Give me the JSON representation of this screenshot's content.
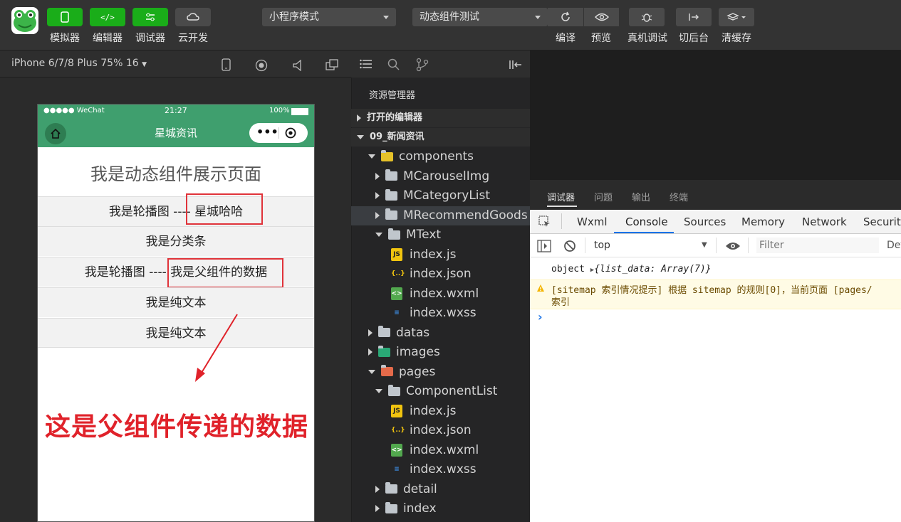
{
  "toolbar": {
    "buttons": [
      {
        "label": "模拟器"
      },
      {
        "label": "编辑器"
      },
      {
        "label": "调试器"
      },
      {
        "label": "云开发"
      }
    ],
    "mode_select": "小程序模式",
    "compile_select": "动态组件测试",
    "right_buttons": [
      {
        "label": "编译"
      },
      {
        "label": "预览"
      },
      {
        "label": "真机调试"
      },
      {
        "label": "切后台"
      },
      {
        "label": "清缓存"
      }
    ]
  },
  "simulator": {
    "device": "iPhone 6/7/8 Plus 75% 16",
    "status": {
      "carrier": "●●●●● WeChat",
      "time": "21:27",
      "battery": "100%"
    },
    "nav_title": "星城资讯",
    "heading": "我是动态组件展示页面",
    "rows": [
      {
        "left": "我是轮播图 ---- ",
        "right": "星城哈哈"
      },
      {
        "text": "我是分类条"
      },
      {
        "left": "我是轮播图 ---- ",
        "right": "我是父组件的数据"
      },
      {
        "text": "我是纯文本"
      },
      {
        "text": "我是纯文本"
      }
    ],
    "annotation": "这是父组件传递的数据"
  },
  "explorer": {
    "title": "资源管理器",
    "open_editors": "打开的编辑器",
    "project": "09_新闻资讯",
    "tree": [
      {
        "label": "components",
        "kind": "folder-open",
        "depth": 1
      },
      {
        "label": "MCarouselImg",
        "kind": "folder",
        "depth": 2
      },
      {
        "label": "MCategoryList",
        "kind": "folder",
        "depth": 2
      },
      {
        "label": "MRecommendGoods",
        "kind": "folder",
        "depth": 2
      },
      {
        "label": "MText",
        "kind": "folder-open",
        "depth": 2
      },
      {
        "label": "index.js",
        "kind": "js",
        "depth": 3
      },
      {
        "label": "index.json",
        "kind": "json",
        "depth": 3
      },
      {
        "label": "index.wxml",
        "kind": "wxml",
        "depth": 3
      },
      {
        "label": "index.wxss",
        "kind": "wxss",
        "depth": 3
      },
      {
        "label": "datas",
        "kind": "folder",
        "depth": 1
      },
      {
        "label": "images",
        "kind": "folder-img",
        "depth": 1
      },
      {
        "label": "pages",
        "kind": "folder-open-red",
        "depth": 1
      },
      {
        "label": "ComponentList",
        "kind": "folder-open",
        "depth": 2
      },
      {
        "label": "index.js",
        "kind": "js",
        "depth": 3
      },
      {
        "label": "index.json",
        "kind": "json",
        "depth": 3
      },
      {
        "label": "index.wxml",
        "kind": "wxml",
        "depth": 3
      },
      {
        "label": "index.wxss",
        "kind": "wxss",
        "depth": 3
      },
      {
        "label": "detail",
        "kind": "folder",
        "depth": 2
      },
      {
        "label": "index",
        "kind": "folder",
        "depth": 2
      }
    ]
  },
  "debugger": {
    "tabs": [
      "调试器",
      "问题",
      "输出",
      "终端"
    ],
    "devtools_tabs": [
      "Wxml",
      "Console",
      "Sources",
      "Memory",
      "Network",
      "Security"
    ],
    "context": "top",
    "filter_placeholder": "Filter",
    "levels": "Def",
    "log1_key": "object",
    "log1_value": "{list_data: Array(7)}",
    "warn_line1": "[sitemap 索引情况提示] 根据 sitemap 的规则[0]，当前页面 [pages/",
    "warn_line2": "索引",
    "prompt": "›"
  }
}
